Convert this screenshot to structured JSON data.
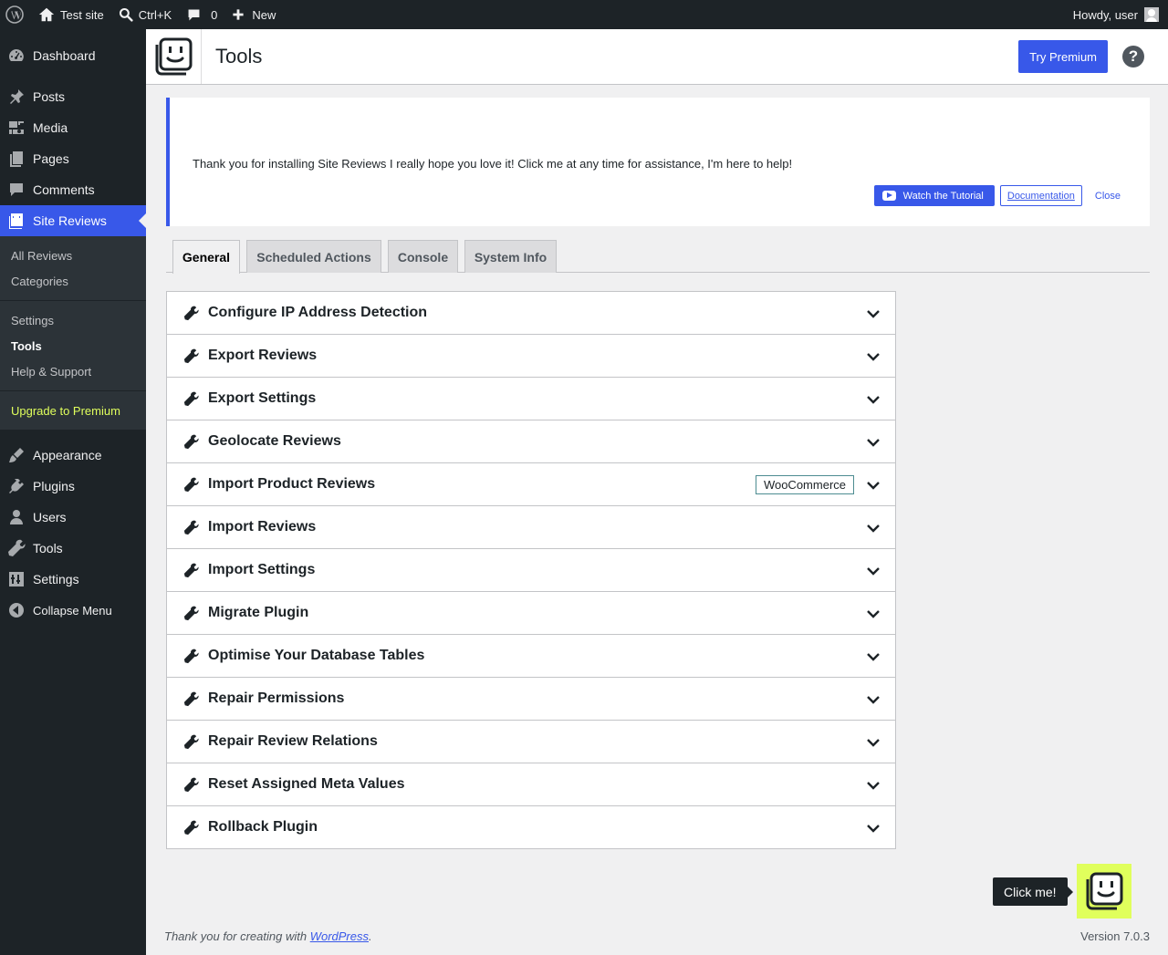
{
  "admin_bar": {
    "site_name": "Test site",
    "search_shortcut": "Ctrl+K",
    "comments_count": "0",
    "new_label": "New",
    "howdy": "Howdy, user"
  },
  "sidebar": {
    "top_items": [
      {
        "label": "Dashboard",
        "icon": "dashboard-icon"
      },
      {
        "label": "Posts",
        "icon": "pin-icon"
      },
      {
        "label": "Media",
        "icon": "media-icon"
      },
      {
        "label": "Pages",
        "icon": "pages-icon"
      },
      {
        "label": "Comments",
        "icon": "comment-icon"
      },
      {
        "label": "Site Reviews",
        "icon": "site-reviews-icon"
      }
    ],
    "submenu": {
      "all_reviews": "All Reviews",
      "categories": "Categories",
      "settings": "Settings",
      "tools": "Tools",
      "help_support": "Help & Support",
      "upgrade": "Upgrade to Premium"
    },
    "bottom_items": [
      {
        "label": "Appearance",
        "icon": "brush-icon"
      },
      {
        "label": "Plugins",
        "icon": "plug-icon"
      },
      {
        "label": "Users",
        "icon": "user-icon"
      },
      {
        "label": "Tools",
        "icon": "wrench-icon"
      },
      {
        "label": "Settings",
        "icon": "settings-icon"
      },
      {
        "label": "Collapse Menu",
        "icon": "collapse-icon"
      }
    ]
  },
  "header": {
    "title": "Tools",
    "try_premium": "Try Premium",
    "help": "?"
  },
  "notice": {
    "message": "Thank you for installing Site Reviews I really hope you love it! Click me at any time for assistance, I'm here to help!",
    "watch_tutorial": "Watch the Tutorial",
    "documentation": "Documentation",
    "close": "Close"
  },
  "tabs": [
    "General",
    "Scheduled Actions",
    "Console",
    "System Info"
  ],
  "tools": [
    {
      "label": "Configure IP Address Detection"
    },
    {
      "label": "Export Reviews"
    },
    {
      "label": "Export Settings"
    },
    {
      "label": "Geolocate Reviews"
    },
    {
      "label": "Import Product Reviews",
      "badge": "WooCommerce"
    },
    {
      "label": "Import Reviews"
    },
    {
      "label": "Import Settings"
    },
    {
      "label": "Migrate Plugin"
    },
    {
      "label": "Optimise Your Database Tables"
    },
    {
      "label": "Repair Permissions"
    },
    {
      "label": "Repair Review Relations"
    },
    {
      "label": "Reset Assigned Meta Values"
    },
    {
      "label": "Rollback Plugin"
    }
  ],
  "helper": {
    "click_me": "Click me!"
  },
  "footer": {
    "thanks_prefix": "Thank you for creating with ",
    "wordpress_link": "WordPress",
    "thanks_suffix": ".",
    "version": "Version 7.0.3"
  },
  "colors": {
    "accent": "#3858e9",
    "admin_bg": "#1d2327",
    "premium_highlight": "#e0ff5c"
  }
}
